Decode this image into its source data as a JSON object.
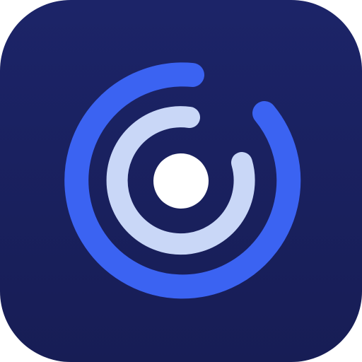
{
  "icon": {
    "name": "concentric-rings-app-icon",
    "colors": {
      "background_top": "#1c2468",
      "background_bottom": "#171d55",
      "outer_ring": "#3b63f2",
      "inner_ring": "#c9d7f7",
      "center_dot": "#ffffff"
    }
  }
}
